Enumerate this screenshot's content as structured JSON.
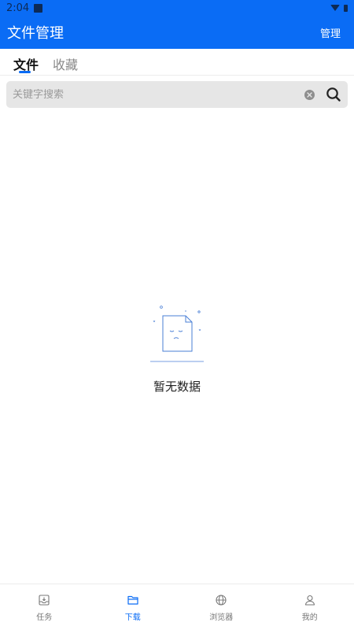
{
  "status_bar": {
    "time": "2:04"
  },
  "app_bar": {
    "title": "文件管理",
    "action_label": "管理"
  },
  "tabs": [
    {
      "label": "文件",
      "active": true
    },
    {
      "label": "收藏",
      "active": false
    }
  ],
  "search": {
    "placeholder": "关键字搜索",
    "value": ""
  },
  "empty_state": {
    "text": "暂无数据"
  },
  "bottom_nav": [
    {
      "label": "任务",
      "icon": "inbox-icon",
      "active": false
    },
    {
      "label": "下载",
      "icon": "folder-icon",
      "active": true
    },
    {
      "label": "浏览器",
      "icon": "globe-icon",
      "active": false
    },
    {
      "label": "我的",
      "icon": "user-icon",
      "active": false
    }
  ],
  "colors": {
    "primary": "#0a6cf5",
    "search_bg": "#e6e6e6",
    "inactive": "#777777"
  }
}
